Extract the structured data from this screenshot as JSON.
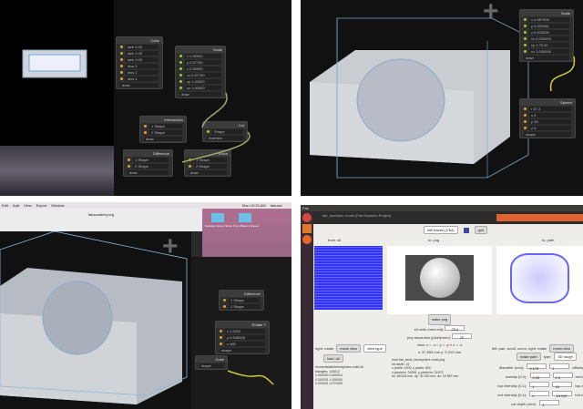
{
  "top_left": {
    "nodes": [
      {
        "title": "Cube",
        "rows": [
          "size 1.00",
          "size 1.00",
          "size 1.00",
          "divs 2",
          "divs 2",
          "divs 1",
          "draw"
        ]
      },
      {
        "title": "Scale",
        "rows": [
          "x 1.00000",
          "y 0.57700",
          "z 0.50000",
          "cx 0.57700",
          "cy 1.00000",
          "cz 1.00000",
          "draw"
        ]
      },
      {
        "title": "Intersection",
        "rows": [
          "1 Shape",
          "2 Shape",
          "draw"
        ]
      },
      {
        "title": "Cut",
        "rows": [
          "Shape",
          "Inverted"
        ]
      },
      {
        "title": "Difference",
        "rows": [
          "1 Shape",
          "2 Shape",
          "draw"
        ]
      },
      {
        "title": "Union",
        "rows": [
          "1 Shape",
          "2 Shape",
          "draw"
        ]
      }
    ]
  },
  "top_right": {
    "nodes": [
      {
        "title": "Scale",
        "rows": [
          "x 0.087900",
          "y 0.393481",
          "z 0.000000",
          "cx 0.000000",
          "cy 1.75.00",
          "cz 1.000000",
          "draw"
        ]
      },
      {
        "title": "Sphere",
        "rows": [
          "r 57.3",
          "x 0",
          "y 26",
          "z 0",
          "shape"
        ]
      }
    ]
  },
  "bottom_left": {
    "menu": [
      "Edit",
      "Add",
      "View",
      "Export",
      "Window"
    ],
    "tab_title": "fabscademy.org",
    "clock": "Mon 10:23 AM",
    "user": "fabuser",
    "desktop_icons": [
      "Desktop Screen Shots",
      "Tony Wilson's Screen"
    ],
    "nodes": [
      {
        "title": "Difference",
        "rows": [
          "1 Shape",
          "2 Shape"
        ]
      },
      {
        "title": "Rotate Y",
        "rows": [
          "x 1.0202",
          "y 0.5480(0)",
          "z 180",
          "shape"
        ]
      },
      {
        "title": "Cube",
        "rows": [
          "shape"
        ]
      }
    ]
  },
  "bottom_right": {
    "top_bar_title": "Fab",
    "window_title": "fab_modules: mods (Fab Modules Project)",
    "process_select": "mill traces (1/64)",
    "quit_label": "quit",
    "col_from": "from: stl",
    "col_to_png": "to: png",
    "col_to_path": "to: path",
    "make_png_label": "make png",
    "stl_units_label": "stl units (mm/unit):",
    "stl_units_value": "25.4",
    "png_res_label": "png resolution (pixels/mm):",
    "png_res_value": "20",
    "axis_label": "view:",
    "axes": [
      "x",
      "-x",
      "y",
      "-y",
      "z",
      "-z"
    ],
    "dims": "x: 37.853 mm  y: 5.313 mm",
    "info_lines": [
      "read fab_send_hemisphere-mold.png",
      "bit depth: 16",
      "x pixels: 1200, y pixels: 800",
      "x pixels/m: 24999, y pixels/m: 24973",
      "dx: 48.003 mm, dy: 32.030 mm, dz: 19.587 mm"
    ],
    "left_hint": "right: rotate",
    "mesh_view_label": "mesh view",
    "view_type": "view type",
    "load_stl_label": "load .stl",
    "stl_info": [
      "/home/fablab/hemisphere-mold.stl",
      "triangles: 144012",
      "0.000000 0.000001",
      "0.000001 1.000000",
      "0.000001 0.070000"
    ],
    "right_hint": "left: pan, scroll: zoom, right: rotate",
    "path_view_label": "mesh view",
    "make_path_label": "make path",
    "path_type_label": "type:",
    "path_type_value": "3D rough",
    "params": [
      {
        "label": "diameter (mm):",
        "a": "3.175",
        "b": "1",
        "c": "offsets"
      },
      {
        "label": "overlap (0-1):",
        "a": "0.25",
        "b": "1.0",
        "c": "error"
      },
      {
        "label": "top intensity (0-1):",
        "a": "1",
        "b": "16",
        "c": "top z"
      },
      {
        "label": "bot intensity (0-1):",
        "a": "0",
        "b": "-19.587",
        "c": "bot z"
      }
    ],
    "cut_depth_label": "cut depth (mm):",
    "cut_depth_value": "1"
  }
}
